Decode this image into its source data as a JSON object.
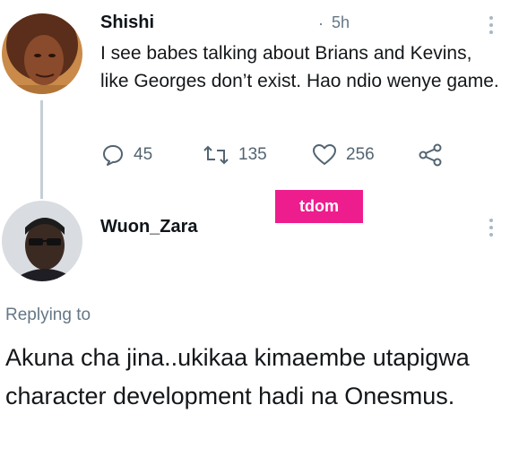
{
  "tweet": {
    "author": "Shishi",
    "time": "5h",
    "time_sep": "·",
    "text": "I see babes talking about Brians and Kevins, like Georges don’t exist. Hao ndio wenye game.",
    "replies": "45",
    "retweets": "135",
    "likes": "256"
  },
  "watermark": "tdom",
  "reply": {
    "author": "Wuon_Zara",
    "replying_to_label": "Replying to",
    "text": "Akuna cha jina..ukikaa kimaembe utapigwa character development hadi na Onesmus."
  },
  "colors": {
    "accent_pink": "#ee1d8d",
    "muted_text": "#657786",
    "thread_line": "#c4cfd6"
  },
  "icons": {
    "reply": "speech-bubble-icon",
    "retweet": "retweet-icon",
    "like": "heart-icon",
    "share": "share-icon",
    "more": "kebab-icon"
  }
}
